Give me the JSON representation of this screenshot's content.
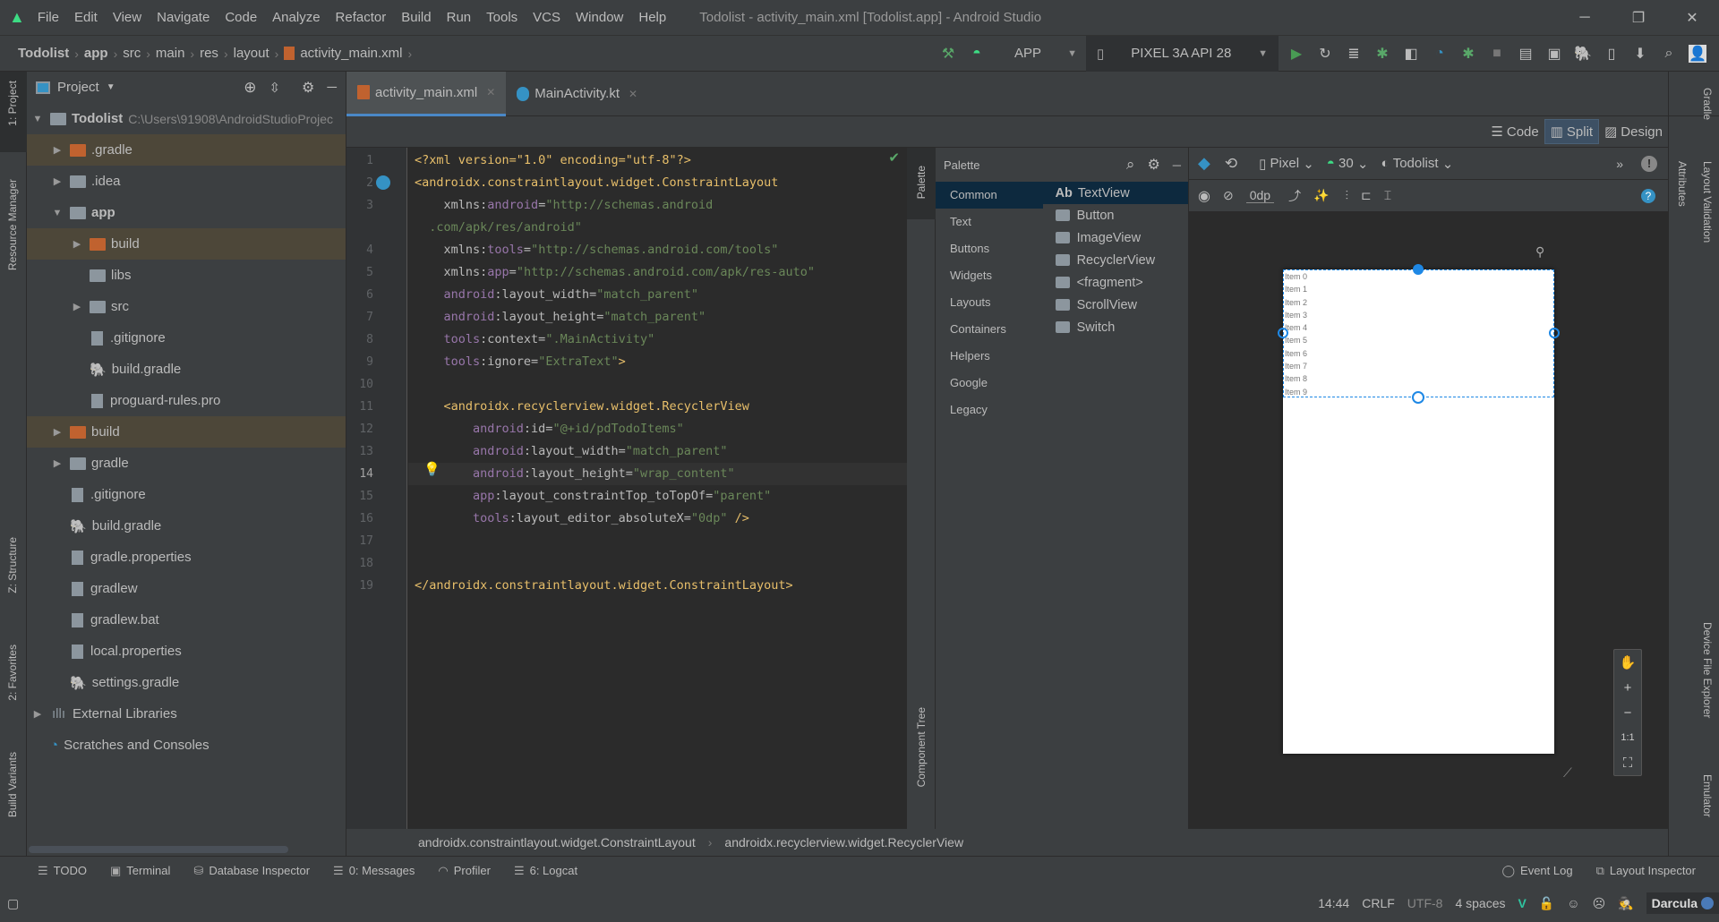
{
  "window": {
    "title": "Todolist - activity_main.xml [Todolist.app] - Android Studio"
  },
  "menu": [
    "File",
    "Edit",
    "View",
    "Navigate",
    "Code",
    "Analyze",
    "Refactor",
    "Build",
    "Run",
    "Tools",
    "VCS",
    "Window",
    "Help"
  ],
  "breadcrumb": [
    "Todolist",
    "app",
    "src",
    "main",
    "res",
    "layout",
    "activity_main.xml"
  ],
  "toolbar": {
    "config": "APP",
    "device": "PIXEL 3A API 28"
  },
  "project": {
    "title": "Project",
    "tree": [
      {
        "level": 0,
        "arrow": "down",
        "icon": "module",
        "label": "Todolist",
        "bold": true,
        "path": "C:\\Users\\91908\\AndroidStudioProjec"
      },
      {
        "level": 1,
        "arrow": "right",
        "icon": "folder-excluded",
        "label": ".gradle",
        "hl": true
      },
      {
        "level": 1,
        "arrow": "right",
        "icon": "folder",
        "label": ".idea"
      },
      {
        "level": 1,
        "arrow": "down",
        "icon": "module",
        "label": "app",
        "bold": true
      },
      {
        "level": 2,
        "arrow": "right",
        "icon": "folder-excluded",
        "label": "build",
        "hl": true
      },
      {
        "level": 2,
        "arrow": "",
        "icon": "folder",
        "label": "libs"
      },
      {
        "level": 2,
        "arrow": "right",
        "icon": "folder",
        "label": "src"
      },
      {
        "level": 2,
        "arrow": "",
        "icon": "file",
        "label": ".gitignore"
      },
      {
        "level": 2,
        "arrow": "",
        "icon": "gradle",
        "label": "build.gradle"
      },
      {
        "level": 2,
        "arrow": "",
        "icon": "file",
        "label": "proguard-rules.pro"
      },
      {
        "level": 1,
        "arrow": "right",
        "icon": "folder-excluded",
        "label": "build",
        "hl": true
      },
      {
        "level": 1,
        "arrow": "right",
        "icon": "folder",
        "label": "gradle"
      },
      {
        "level": 1,
        "arrow": "",
        "icon": "file",
        "label": ".gitignore"
      },
      {
        "level": 1,
        "arrow": "",
        "icon": "gradle",
        "label": "build.gradle"
      },
      {
        "level": 1,
        "arrow": "",
        "icon": "properties",
        "label": "gradle.properties"
      },
      {
        "level": 1,
        "arrow": "",
        "icon": "file",
        "label": "gradlew"
      },
      {
        "level": 1,
        "arrow": "",
        "icon": "file",
        "label": "gradlew.bat"
      },
      {
        "level": 1,
        "arrow": "",
        "icon": "properties",
        "label": "local.properties"
      },
      {
        "level": 1,
        "arrow": "",
        "icon": "gradle",
        "label": "settings.gradle"
      },
      {
        "level": 0,
        "arrow": "right",
        "icon": "libraries",
        "label": "External Libraries"
      },
      {
        "level": 0,
        "arrow": "",
        "icon": "scratches",
        "label": "Scratches and Consoles"
      }
    ]
  },
  "tabs": [
    {
      "label": "activity_main.xml",
      "active": true
    },
    {
      "label": "MainActivity.kt",
      "active": false
    }
  ],
  "modes": {
    "code": "Code",
    "split": "Split",
    "design": "Design",
    "active": "split"
  },
  "editor": {
    "current_line": 14,
    "lines": [
      {
        "n": "1",
        "t": [
          [
            "pi",
            "<?xml version=\"1.0\" encoding=\"utf-8\"?>"
          ]
        ]
      },
      {
        "n": "2",
        "t": [
          [
            "tag",
            "<androidx.constraintlayout.widget.ConstraintLayout"
          ]
        ]
      },
      {
        "n": "3",
        "t": [
          [
            "attr",
            "    xmlns:"
          ],
          [
            "ns",
            "android"
          ],
          [
            "attr",
            "="
          ],
          [
            "val",
            "\"http://schemas.android"
          ]
        ]
      },
      {
        "n": "",
        "t": [
          [
            "val",
            "  .com/apk/res/android\""
          ]
        ]
      },
      {
        "n": "4",
        "t": [
          [
            "attr",
            "    xmlns:"
          ],
          [
            "ns",
            "tools"
          ],
          [
            "attr",
            "="
          ],
          [
            "val",
            "\"http://schemas.android.com/tools\""
          ]
        ]
      },
      {
        "n": "5",
        "t": [
          [
            "attr",
            "    xmlns:"
          ],
          [
            "ns",
            "app"
          ],
          [
            "attr",
            "="
          ],
          [
            "val",
            "\"http://schemas.android.com/apk/res-auto\""
          ]
        ]
      },
      {
        "n": "6",
        "t": [
          [
            "ns",
            "    android"
          ],
          [
            "attr",
            ":layout_width="
          ],
          [
            "val",
            "\"match_parent\""
          ]
        ]
      },
      {
        "n": "7",
        "t": [
          [
            "ns",
            "    android"
          ],
          [
            "attr",
            ":layout_height="
          ],
          [
            "val",
            "\"match_parent\""
          ]
        ]
      },
      {
        "n": "8",
        "t": [
          [
            "ns",
            "    tools"
          ],
          [
            "attr",
            ":context="
          ],
          [
            "val",
            "\".MainActivity\""
          ]
        ]
      },
      {
        "n": "9",
        "t": [
          [
            "ns",
            "    tools"
          ],
          [
            "attr",
            ":ignore="
          ],
          [
            "val",
            "\"ExtraText\""
          ],
          [
            "tag",
            ">"
          ]
        ]
      },
      {
        "n": "10",
        "t": []
      },
      {
        "n": "11",
        "t": [
          [
            "tag",
            "    <androidx.recyclerview.widget.RecyclerView"
          ]
        ]
      },
      {
        "n": "12",
        "t": [
          [
            "ns",
            "        android"
          ],
          [
            "attr",
            ":id="
          ],
          [
            "val",
            "\"@+id/pdTodoItems\""
          ]
        ]
      },
      {
        "n": "13",
        "t": [
          [
            "ns",
            "        android"
          ],
          [
            "attr",
            ":layout_width="
          ],
          [
            "val",
            "\"match_parent\""
          ]
        ]
      },
      {
        "n": "14",
        "t": [
          [
            "ns",
            "        android"
          ],
          [
            "attr",
            ":layout_height="
          ],
          [
            "val",
            "\"wrap_content\""
          ]
        ]
      },
      {
        "n": "15",
        "t": [
          [
            "ns",
            "        app"
          ],
          [
            "attr",
            ":layout_constraintTop_toTopOf="
          ],
          [
            "val",
            "\"parent\""
          ]
        ]
      },
      {
        "n": "16",
        "t": [
          [
            "ns",
            "        tools"
          ],
          [
            "attr",
            ":layout_editor_absoluteX="
          ],
          [
            "val",
            "\"0dp\""
          ],
          [
            "tag",
            " />"
          ]
        ]
      },
      {
        "n": "17",
        "t": []
      },
      {
        "n": "18",
        "t": []
      },
      {
        "n": "19",
        "t": [
          [
            "tag",
            "</androidx.constraintlayout.widget.ConstraintLayout>"
          ]
        ]
      }
    ]
  },
  "palette": {
    "title": "Palette",
    "strip_label": "Palette",
    "tree_label": "Component Tree",
    "categories": [
      "Common",
      "Text",
      "Buttons",
      "Widgets",
      "Layouts",
      "Containers",
      "Helpers",
      "Google",
      "Legacy"
    ],
    "widgets": [
      {
        "icon": "ab",
        "label": "TextView"
      },
      {
        "icon": "button",
        "label": "Button"
      },
      {
        "icon": "image",
        "label": "ImageView"
      },
      {
        "icon": "list",
        "label": "RecyclerView"
      },
      {
        "icon": "code",
        "label": "<fragment>"
      },
      {
        "icon": "scroll",
        "label": "ScrollView"
      },
      {
        "icon": "switch",
        "label": "Switch"
      }
    ],
    "selected_category": "Common",
    "selected_widget": "TextView",
    "ab": "Ab"
  },
  "design": {
    "device": "Pixel",
    "api": "30",
    "theme": "Todolist",
    "margin": "0dp",
    "zoom_fit": "1:1",
    "items": [
      "Item 0",
      "Item 1",
      "Item 2",
      "Item 3",
      "Item 4",
      "Item 5",
      "Item 6",
      "Item 7",
      "Item 8",
      "Item 9"
    ]
  },
  "right_tools": [
    "Gradle",
    "Layout Validation",
    "Attributes",
    "Device File Explorer",
    "Emulator"
  ],
  "left_tools": [
    "1: Project",
    "Resource Manager",
    "Z: Structure",
    "2: Favorites",
    "Build Variants"
  ],
  "component_path": [
    "androidx.constraintlayout.widget.ConstraintLayout",
    "androidx.recyclerview.widget.RecyclerView"
  ],
  "tool_windows": [
    {
      "icon": "☰",
      "label": "TODO"
    },
    {
      "icon": "▣",
      "label": "Terminal"
    },
    {
      "icon": "⛁",
      "label": "Database Inspector"
    },
    {
      "icon": "☰",
      "label": "0: Messages"
    },
    {
      "icon": "◠",
      "label": "Profiler"
    },
    {
      "icon": "☰",
      "label": "6: Logcat"
    }
  ],
  "tool_windows_right": [
    {
      "icon": "◯",
      "label": "Event Log"
    },
    {
      "icon": "⧉",
      "label": "Layout Inspector"
    }
  ],
  "status": {
    "position": "14:44",
    "line_sep": "CRLF",
    "encoding": "UTF-8",
    "indent": "4 spaces",
    "theme": "Darcula"
  }
}
